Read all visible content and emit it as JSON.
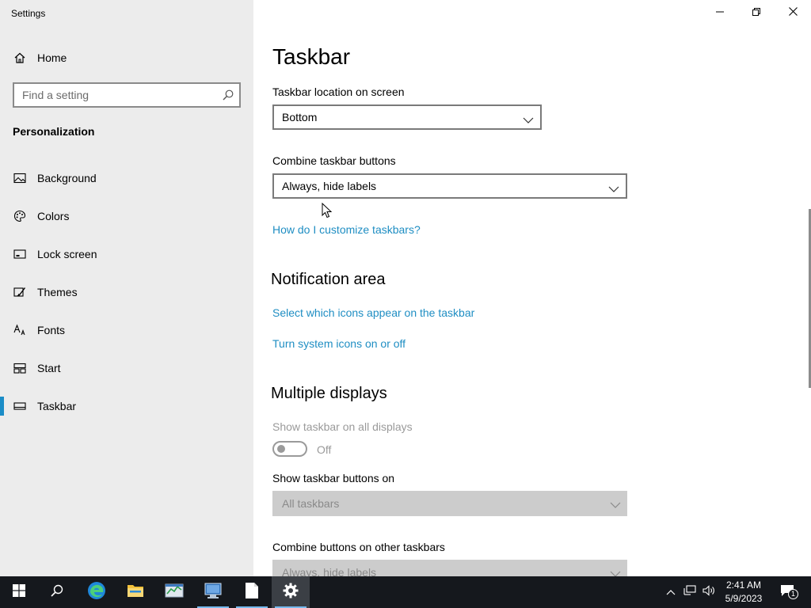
{
  "window": {
    "title": "Settings"
  },
  "sidebar": {
    "home_label": "Home",
    "search_placeholder": "Find a setting",
    "section_heading": "Personalization",
    "items": [
      {
        "label": "Background",
        "icon": "picture-icon"
      },
      {
        "label": "Colors",
        "icon": "palette-icon"
      },
      {
        "label": "Lock screen",
        "icon": "lock-screen-icon"
      },
      {
        "label": "Themes",
        "icon": "brush-icon"
      },
      {
        "label": "Fonts",
        "icon": "font-icon"
      },
      {
        "label": "Start",
        "icon": "start-tiles-icon"
      },
      {
        "label": "Taskbar",
        "icon": "taskbar-icon",
        "selected": true
      }
    ]
  },
  "main": {
    "page_title": "Taskbar",
    "location_label": "Taskbar location on screen",
    "location_value": "Bottom",
    "combine_label": "Combine taskbar buttons",
    "combine_value": "Always, hide labels",
    "customize_link": "How do I customize taskbars?",
    "notification_heading": "Notification area",
    "select_icons_link": "Select which icons appear on the taskbar",
    "system_icons_link": "Turn system icons on or off",
    "multiple_heading": "Multiple displays",
    "show_all_label": "Show taskbar on all displays",
    "show_all_state": "Off",
    "show_buttons_label": "Show taskbar buttons on",
    "show_buttons_value": "All taskbars",
    "combine_other_label": "Combine buttons on other taskbars",
    "combine_other_value": "Always, hide labels"
  },
  "taskbar": {
    "apps": [
      {
        "name": "start-icon"
      },
      {
        "name": "search-icon"
      },
      {
        "name": "edge-icon"
      },
      {
        "name": "file-explorer-icon"
      },
      {
        "name": "task-manager-icon"
      },
      {
        "name": "network-app-icon",
        "running": true
      },
      {
        "name": "notepad-icon",
        "running": true
      },
      {
        "name": "settings-gear-icon",
        "running": true,
        "active": true
      }
    ],
    "time": "2:41 AM",
    "date": "5/9/2023",
    "notification_count": "1"
  },
  "colors": {
    "accent": "#1b8dc7",
    "link": "#1f8ec3",
    "sidebar_bg": "#ececec",
    "taskbar_bg": "#15181d"
  }
}
